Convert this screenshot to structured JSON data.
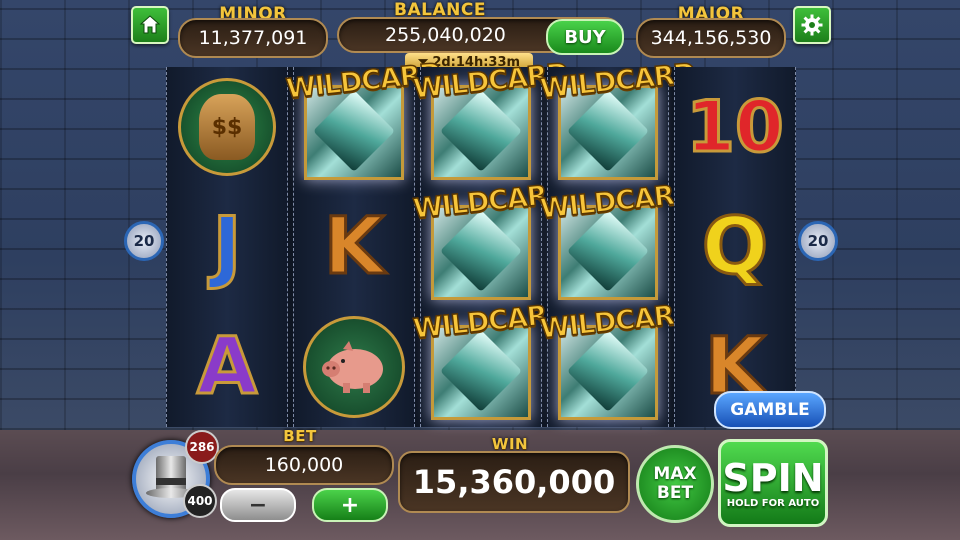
{
  "top": {
    "minor_label": "MINOR",
    "minor_value": "11,377,091",
    "balance_label": "BALANCE",
    "balance_value": "255,040,020",
    "buy_label": "BUY",
    "timer": "2d:14h:33m",
    "major_label": "MAJOR",
    "major_value": "344,156,530"
  },
  "reels": {
    "wild_text": "WILDCARD",
    "reel1": [
      "$$",
      "J",
      "A"
    ],
    "reel2": [
      "WILDCARD",
      "K",
      "pig"
    ],
    "reel5": [
      "10",
      "Q",
      "K"
    ]
  },
  "lines": {
    "left": "20",
    "right": "20"
  },
  "bottom": {
    "gamble_label": "GAMBLE",
    "level_current": "286",
    "level_next": "400",
    "bet_label": "BET",
    "bet_value": "160,000",
    "minus_label": "−",
    "plus_label": "+",
    "win_label": "WIN",
    "win_value": "15,360,000",
    "max_label_1": "MAX",
    "max_label_2": "BET",
    "spin_label": "SPIN",
    "spin_sub": "HOLD FOR AUTO"
  },
  "colors": {
    "gold": "#f2c53d",
    "green": "#2aa82a",
    "blue": "#2b66b5"
  }
}
